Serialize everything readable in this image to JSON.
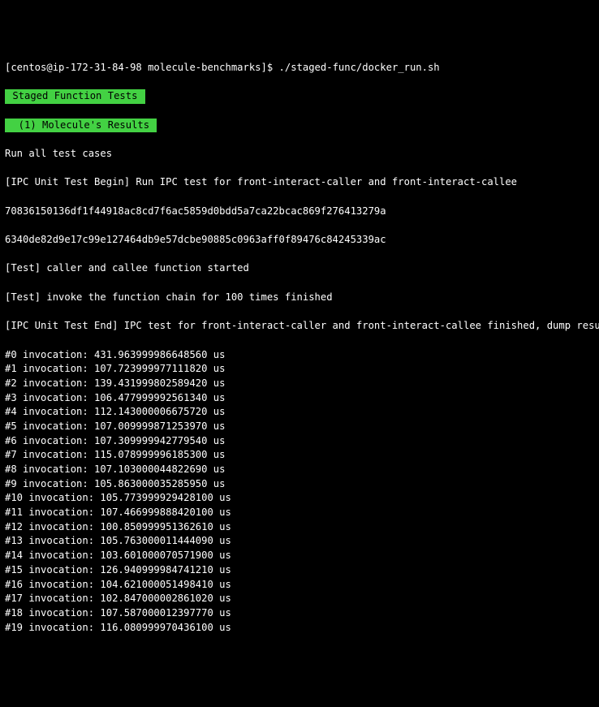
{
  "prompt": "[centos@ip-172-31-84-98 molecule-benchmarks]$ ",
  "command": "./staged-func/docker_run.sh",
  "banner1": " Staged Function Tests ",
  "banner2": "  (1) Molecule's Results ",
  "runAll": "Run all test cases",
  "ipcBegin": "[IPC Unit Test Begin] Run IPC test for front-interact-caller and front-interact-callee",
  "hash1": "70836150136df1f44918ac8cd7f6ac5859d0bdd5a7ca22bcac869f276413279a",
  "hash2": "6340de82d9e17c99e127464db9e57dcbe90885c0963aff0f89476c84245339ac",
  "test1": "[Test] caller and callee function started",
  "test2": "[Test] invoke the function chain for 100 times finished",
  "ipcEnd": "[IPC Unit Test End] IPC test for front-interact-caller and front-interact-callee finished, dump results:",
  "invocations": [
    {
      "idx": 0,
      "val": "431.963999986648560"
    },
    {
      "idx": 1,
      "val": "107.723999977111820"
    },
    {
      "idx": 2,
      "val": "139.431999802589420"
    },
    {
      "idx": 3,
      "val": "106.477999992561340"
    },
    {
      "idx": 4,
      "val": "112.143000006675720"
    },
    {
      "idx": 5,
      "val": "107.009999871253970"
    },
    {
      "idx": 6,
      "val": "107.309999942779540"
    },
    {
      "idx": 7,
      "val": "115.078999996185300"
    },
    {
      "idx": 8,
      "val": "107.103000044822690"
    },
    {
      "idx": 9,
      "val": "105.863000035285950"
    },
    {
      "idx": 10,
      "val": "105.773999929428100"
    },
    {
      "idx": 11,
      "val": "107.466999888420100"
    },
    {
      "idx": 12,
      "val": "100.850999951362610"
    },
    {
      "idx": 13,
      "val": "105.763000011444090"
    },
    {
      "idx": 14,
      "val": "103.601000070571900"
    },
    {
      "idx": 15,
      "val": "126.940999984741210"
    },
    {
      "idx": 16,
      "val": "104.621000051498410"
    },
    {
      "idx": 17,
      "val": "102.847000002861020"
    },
    {
      "idx": 18,
      "val": "107.587000012397770"
    },
    {
      "idx": 19,
      "val": "116.080999970436100"
    }
  ],
  "unit": "us"
}
